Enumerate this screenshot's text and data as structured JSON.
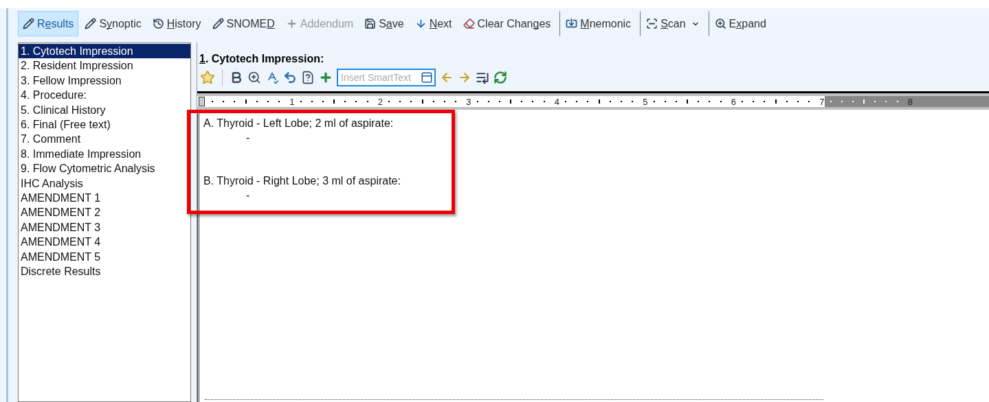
{
  "toolbar": [
    {
      "kind": "pencil",
      "parts": [
        {
          "text": "R",
          "underline": false
        },
        {
          "text": "e",
          "underline": true
        },
        {
          "text": "sults",
          "underline": false
        }
      ],
      "selected": true,
      "disabled": false,
      "separator_before": false,
      "dropdown": false
    },
    {
      "kind": "pencil",
      "parts": [
        {
          "text": "S",
          "underline": false
        },
        {
          "text": "y",
          "underline": true
        },
        {
          "text": "noptic",
          "underline": false
        }
      ],
      "selected": false,
      "disabled": false,
      "separator_before": false,
      "dropdown": false
    },
    {
      "kind": "history",
      "parts": [
        {
          "text": "H",
          "underline": true
        },
        {
          "text": "istory",
          "underline": false
        }
      ],
      "selected": false,
      "disabled": false,
      "separator_before": false,
      "dropdown": false
    },
    {
      "kind": "pencil",
      "parts": [
        {
          "text": "SNOME",
          "underline": false
        },
        {
          "text": "D",
          "underline": true
        }
      ],
      "selected": false,
      "disabled": false,
      "separator_before": false,
      "dropdown": false
    },
    {
      "kind": "plus",
      "parts": [
        {
          "text": "Addendum",
          "underline": false
        }
      ],
      "selected": false,
      "disabled": true,
      "separator_before": false,
      "dropdown": false
    },
    {
      "kind": "save",
      "parts": [
        {
          "text": "S",
          "underline": false
        },
        {
          "text": "a",
          "underline": true
        },
        {
          "text": "ve",
          "underline": false
        }
      ],
      "selected": false,
      "disabled": false,
      "separator_before": false,
      "dropdown": false
    },
    {
      "kind": "down",
      "parts": [
        {
          "text": "N",
          "underline": true
        },
        {
          "text": "ext",
          "underline": false
        }
      ],
      "selected": false,
      "disabled": false,
      "separator_before": false,
      "dropdown": false
    },
    {
      "kind": "eraser",
      "parts": [
        {
          "text": "Clear Chan",
          "underline": false
        },
        {
          "text": "g",
          "underline": true
        },
        {
          "text": "es",
          "underline": false
        }
      ],
      "selected": false,
      "disabled": false,
      "separator_before": false,
      "dropdown": false
    },
    {
      "kind": "import",
      "parts": [
        {
          "text": "M",
          "underline": true
        },
        {
          "text": "nemonic",
          "underline": false
        }
      ],
      "selected": false,
      "disabled": false,
      "separator_before": true,
      "dropdown": false
    },
    {
      "kind": "scan",
      "parts": [
        {
          "text": "S",
          "underline": true
        },
        {
          "text": "can",
          "underline": false
        }
      ],
      "selected": false,
      "disabled": false,
      "separator_before": true,
      "dropdown": true
    },
    {
      "kind": "zoom",
      "parts": [
        {
          "text": "E",
          "underline": false
        },
        {
          "text": "x",
          "underline": true
        },
        {
          "text": "pand",
          "underline": false
        }
      ],
      "selected": false,
      "disabled": false,
      "separator_before": true,
      "dropdown": false
    }
  ],
  "sections": [
    {
      "label": "1. Cytotech Impression",
      "selected": true
    },
    {
      "label": "2. Resident Impression",
      "selected": false
    },
    {
      "label": "3. Fellow Impression",
      "selected": false
    },
    {
      "label": "4. Procedure:",
      "selected": false
    },
    {
      "label": "5. Clinical History",
      "selected": false
    },
    {
      "label": "6. Final (Free text)",
      "selected": false
    },
    {
      "label": "7. Comment",
      "selected": false
    },
    {
      "label": "8. Immediate Impression",
      "selected": false
    },
    {
      "label": "9. Flow Cytometric Analysis",
      "selected": false
    },
    {
      "label": "IHC Analysis",
      "selected": false
    },
    {
      "label": "AMENDMENT 1",
      "selected": false
    },
    {
      "label": "AMENDMENT 2",
      "selected": false
    },
    {
      "label": "AMENDMENT 3",
      "selected": false
    },
    {
      "label": "AMENDMENT 4",
      "selected": false
    },
    {
      "label": "AMENDMENT 5",
      "selected": false
    },
    {
      "label": "Discrete Results",
      "selected": false
    }
  ],
  "editor": {
    "heading_parts": [
      {
        "text": "1",
        "underline": true
      },
      {
        "text": ". Cytotech Impression:",
        "underline": false
      }
    ],
    "smarttext": {
      "placeholder": "Insert SmartText"
    },
    "ruler": [
      {
        "label": "1",
        "margin": false
      },
      {
        "label": "2",
        "margin": false
      },
      {
        "label": "3",
        "margin": false
      },
      {
        "label": "4",
        "margin": false
      },
      {
        "label": "5",
        "margin": false
      },
      {
        "label": "6",
        "margin": false
      },
      {
        "label": "7",
        "margin": false
      },
      {
        "label": "8",
        "margin": true
      }
    ],
    "paragraphs": [
      {
        "heading": "A. Thyroid - Left Lobe; 2 ml of aspirate:",
        "value": "-"
      },
      {
        "heading": "B. Thyroid - Right Lobe; 3 ml of aspirate:",
        "value": "-"
      }
    ]
  }
}
